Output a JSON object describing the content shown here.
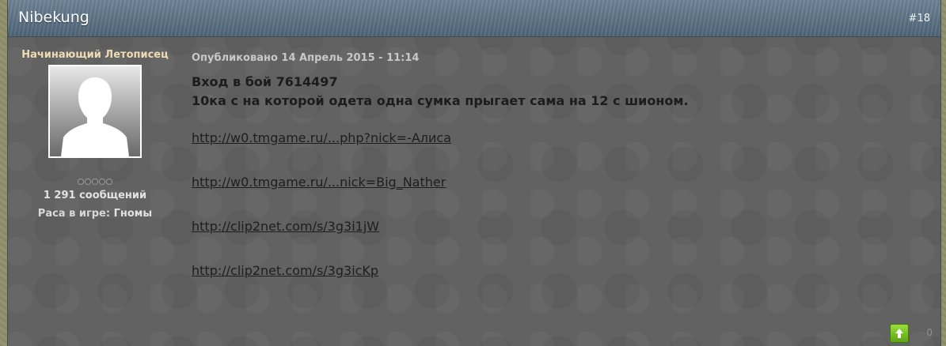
{
  "post": {
    "author": "Nibekung",
    "number": "#18",
    "rank": "Начинающий Летописец",
    "post_count": "1 291 сообщений",
    "race_label": "Раса в игре:",
    "race_value": "Гномы",
    "posted": "Опубликовано 14 Апрель 2015 - 11:14",
    "lines": [
      "Вход в бой 7614497",
      "10ка с на которой одета одна сумка прыгает сама на 12 с шионом."
    ],
    "links": [
      "http://w0.tmgame.ru/...php?nick=-Алиса",
      "http://w0.tmgame.ru/...nick=Big_Nather",
      "http://clip2net.com/s/3g3i1jW",
      "http://clip2net.com/s/3g3icKp"
    ],
    "reputation": "0",
    "icons": {
      "avatar": "default-avatar-icon",
      "up": "arrow-up-icon"
    },
    "colors": {
      "accent_name": "#f0dcb4",
      "up_button": "#6fb71e"
    }
  }
}
